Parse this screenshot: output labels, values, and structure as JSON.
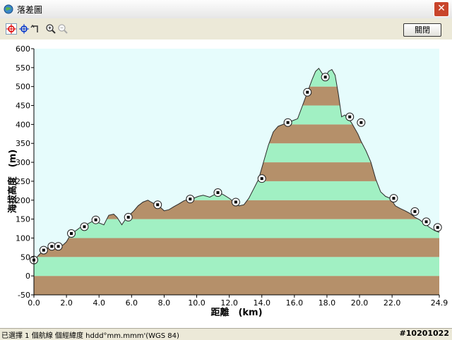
{
  "window": {
    "title": "落差圖",
    "close_glyph": "✕"
  },
  "toolbar": {
    "tools": [
      {
        "name": "crosshair-red-icon"
      },
      {
        "name": "crosshair-blue-icon"
      },
      {
        "name": "rotate-icon"
      },
      {
        "name": "zoom-in-icon"
      },
      {
        "name": "zoom-out-icon"
      }
    ],
    "close_label": "關閉"
  },
  "status": {
    "selection": "已選擇 1 個航線 個",
    "format": "經緯度 hddd°mm.mmm'(WGS 84)",
    "id": "#10201022"
  },
  "chart_data": {
    "type": "area",
    "xlabel": "距離　(km)",
    "ylabel": "海拔高度　(m)",
    "xlim": [
      0,
      24.9
    ],
    "ylim": [
      -50,
      600
    ],
    "xticks": [
      "0.0",
      "2.0",
      "4.0",
      "6.0",
      "8.0",
      "10.0",
      "12.0",
      "14.0",
      "16.0",
      "18.0",
      "20.0",
      "22.0",
      "24.9"
    ],
    "xtick_values": [
      0,
      2,
      4,
      6,
      8,
      10,
      12,
      14,
      16,
      18,
      20,
      22,
      24.9
    ],
    "yticks": [
      -50,
      0,
      50,
      100,
      150,
      200,
      250,
      300,
      350,
      400,
      450,
      500,
      550,
      600
    ],
    "band_colors": [
      "#a1f0c3",
      "#b5906a"
    ],
    "background": "#e6fcfc",
    "x": [
      0,
      0.3,
      0.6,
      0.9,
      1.2,
      1.5,
      1.8,
      2.0,
      2.3,
      2.6,
      2.9,
      3.2,
      3.5,
      3.8,
      4.0,
      4.3,
      4.6,
      4.9,
      5.1,
      5.4,
      5.6,
      5.8,
      6.1,
      6.4,
      6.7,
      7.0,
      7.2,
      7.5,
      7.8,
      8.0,
      8.3,
      8.6,
      8.9,
      9.2,
      9.5,
      9.8,
      10.1,
      10.4,
      10.8,
      11.1,
      11.4,
      11.7,
      12.0,
      12.3,
      12.6,
      12.9,
      13.2,
      13.5,
      13.8,
      14.1,
      14.4,
      14.7,
      15.0,
      15.3,
      15.6,
      15.9,
      16.2,
      16.5,
      16.8,
      17.1,
      17.3,
      17.5,
      17.7,
      17.9,
      18.1,
      18.3,
      18.5,
      18.7,
      18.9,
      19.1,
      19.3,
      19.5,
      19.7,
      19.9,
      20.1,
      20.4,
      20.7,
      21.0,
      21.3,
      21.6,
      21.9,
      22.2,
      22.5,
      22.8,
      23.1,
      23.4,
      23.7,
      24.0,
      24.3,
      24.6,
      24.9
    ],
    "y": [
      40,
      55,
      68,
      75,
      78,
      80,
      82,
      90,
      112,
      120,
      130,
      135,
      142,
      148,
      140,
      135,
      160,
      163,
      155,
      135,
      148,
      158,
      170,
      185,
      195,
      200,
      195,
      188,
      180,
      172,
      175,
      183,
      190,
      198,
      203,
      205,
      210,
      213,
      208,
      215,
      220,
      213,
      205,
      195,
      185,
      188,
      205,
      230,
      255,
      300,
      345,
      380,
      395,
      400,
      405,
      410,
      415,
      450,
      485,
      520,
      540,
      548,
      535,
      525,
      540,
      545,
      530,
      480,
      420,
      425,
      415,
      405,
      390,
      375,
      355,
      330,
      300,
      255,
      222,
      210,
      205,
      185,
      178,
      172,
      165,
      155,
      148,
      138,
      128,
      120,
      115
    ],
    "markers_x": [
      0.0,
      0.6,
      1.1,
      1.5,
      2.3,
      3.1,
      3.8,
      5.8,
      7.6,
      9.6,
      11.3,
      12.4,
      14.0,
      15.6,
      16.8,
      17.9,
      19.4,
      20.1,
      22.1,
      23.4,
      24.1,
      24.8
    ],
    "markers_y": [
      42,
      68,
      78,
      78,
      112,
      130,
      148,
      155,
      188,
      203,
      220,
      195,
      257,
      405,
      485,
      525,
      420,
      405,
      205,
      170,
      143,
      128
    ]
  }
}
